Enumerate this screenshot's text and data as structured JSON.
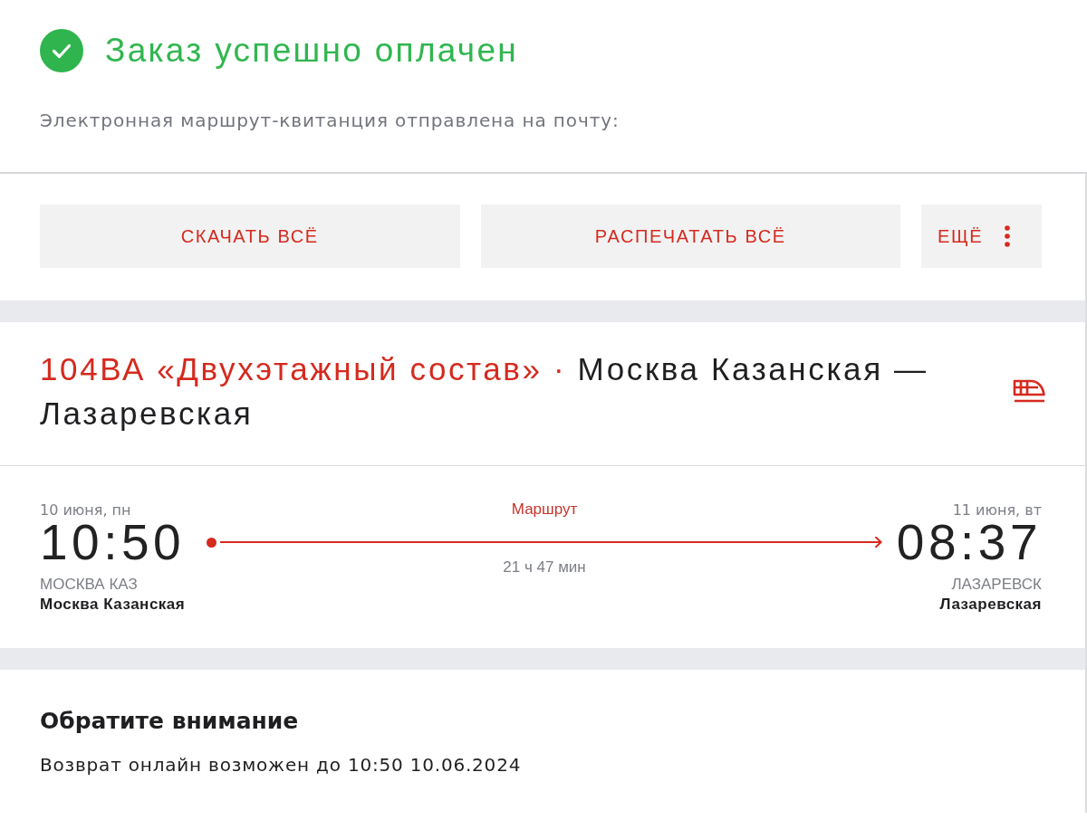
{
  "status": {
    "title": "Заказ успешно оплачен",
    "message": "Электронная маршрут-квитанция отправлена на почту:"
  },
  "actions": [
    {
      "label": "СКАЧАТЬ ВСЁ",
      "kind": "plain"
    },
    {
      "label": "РАСПЕЧАТАТЬ ВСЁ",
      "kind": "plain"
    },
    {
      "label": "ЕЩЁ",
      "kind": "menu"
    }
  ],
  "train": {
    "name": "104ВА «Двухэтажный состав»",
    "separator": "·",
    "route": "Москва Казанская — Лазаревская"
  },
  "trip": {
    "departure": {
      "date": "10 июня, пн",
      "time": "10:50",
      "station_code": "МОСКВА КАЗ",
      "station": "Москва Казанская"
    },
    "route_label": "Маршрут",
    "duration": "21 ч 47 мин",
    "arrival": {
      "date": "11 июня, вт",
      "time": "08:37",
      "station_code": "ЛАЗАРЕВСК",
      "station": "Лазаревская"
    }
  },
  "notice": {
    "title": "Обратите внимание",
    "text": "Возврат онлайн возможен до 10:50 10.06.2024"
  }
}
